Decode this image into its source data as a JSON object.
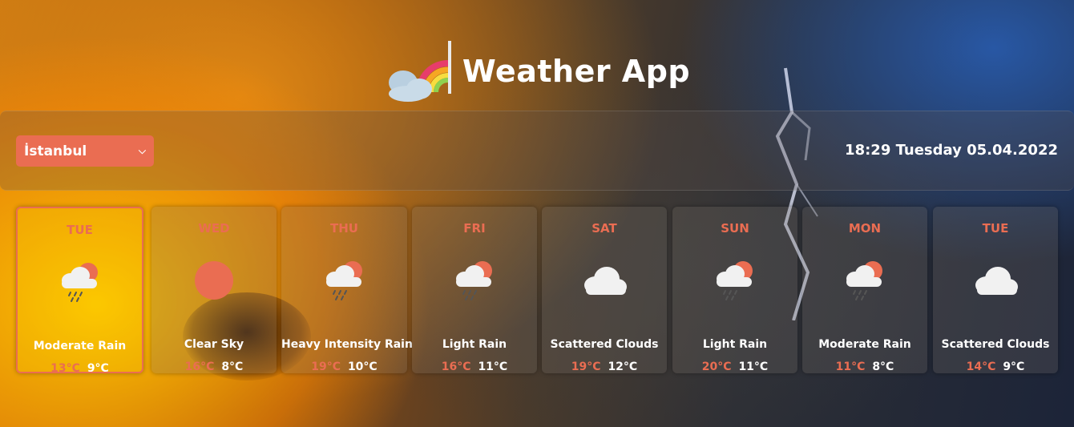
{
  "header": {
    "title": "Weather App",
    "logo_icon": "rainbow-cloud-icon"
  },
  "city_select": {
    "value": "İstanbul"
  },
  "datetime": "18:29 Tuesday 05.04.2022",
  "colors": {
    "accent": "#ea6d52"
  },
  "forecast": [
    {
      "day": "TUE",
      "icon": "rain-sun-cloud-icon",
      "description": "Moderate Rain",
      "max": "13°C",
      "min": "9°C",
      "selected": true
    },
    {
      "day": "WED",
      "icon": "sun-icon",
      "description": "Clear Sky",
      "max": "16°C",
      "min": "8°C"
    },
    {
      "day": "THU",
      "icon": "rain-sun-cloud-icon",
      "description": "Heavy Intensity Rain",
      "max": "19°C",
      "min": "10°C"
    },
    {
      "day": "FRI",
      "icon": "rain-sun-cloud-icon",
      "description": "Light Rain",
      "max": "16°C",
      "min": "11°C"
    },
    {
      "day": "SAT",
      "icon": "cloud-icon",
      "description": "Scattered Clouds",
      "max": "19°C",
      "min": "12°C"
    },
    {
      "day": "SUN",
      "icon": "rain-sun-cloud-icon",
      "description": "Light Rain",
      "max": "20°C",
      "min": "11°C"
    },
    {
      "day": "MON",
      "icon": "rain-sun-cloud-icon",
      "description": "Moderate Rain",
      "max": "11°C",
      "min": "8°C"
    },
    {
      "day": "TUE",
      "icon": "cloud-icon",
      "description": "Scattered Clouds",
      "max": "14°C",
      "min": "9°C"
    }
  ]
}
